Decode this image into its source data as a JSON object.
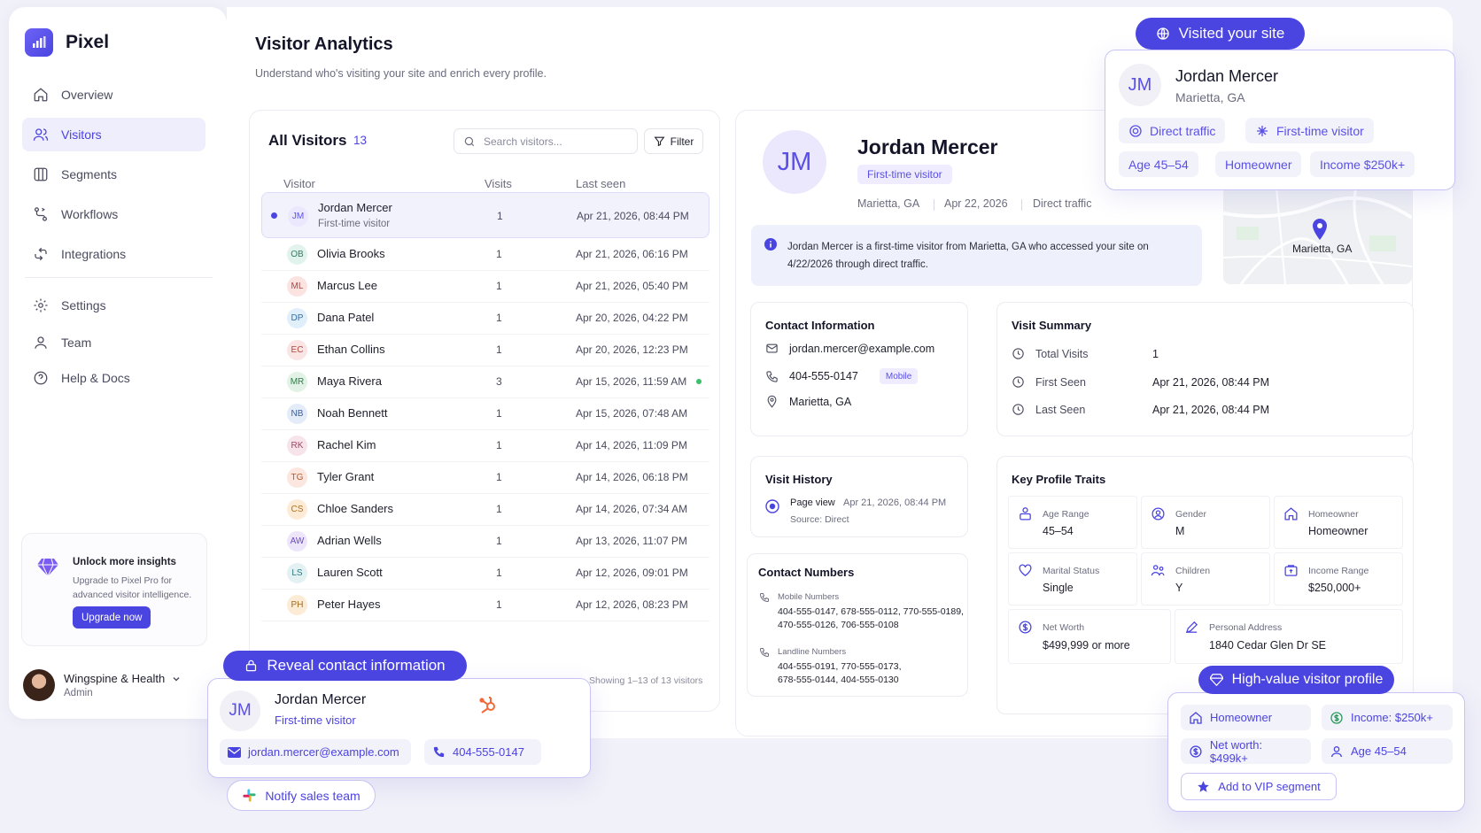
{
  "brand": {
    "name": "Pixel"
  },
  "nav": {
    "items": [
      {
        "label": "Overview",
        "icon": "home-icon"
      },
      {
        "label": "Visitors",
        "icon": "users-icon"
      },
      {
        "label": "Segments",
        "icon": "segments-icon"
      },
      {
        "label": "Workflows",
        "icon": "workflow-icon"
      },
      {
        "label": "Integrations",
        "icon": "integrations-icon"
      },
      {
        "label": "Settings",
        "icon": "gear-icon"
      },
      {
        "label": "Team",
        "icon": "team-icon"
      },
      {
        "label": "Help & Docs",
        "icon": "help-icon"
      }
    ]
  },
  "upsell": {
    "title": "Unlock more insights",
    "desc": "Upgrade to Pixel Pro for advanced visitor intelligence.",
    "button": "Upgrade now"
  },
  "account": {
    "name": "Wingspine & Health",
    "role": "Admin"
  },
  "page": {
    "title": "Visitor Analytics",
    "subtitle": "Understand who's visiting your site and enrich every profile."
  },
  "list": {
    "title": "All Visitors",
    "count": "13",
    "search_placeholder": "Search visitors...",
    "filter": "Filter",
    "col_visitor": "Visitor",
    "col_visits": "Visits",
    "col_last_seen": "Last seen",
    "rows": [
      {
        "initials": "JM",
        "name": "Jordan Mercer",
        "sub": "First-time visitor",
        "visits": "1",
        "last_seen": "Apr 21, 2026, 08:44 PM",
        "bg": "#ebe8fd",
        "fg": "#5a50e6"
      },
      {
        "initials": "OB",
        "name": "Olivia Brooks",
        "visits": "1",
        "last_seen": "Apr 21, 2026, 06:16 PM",
        "bg": "#e2f3ee",
        "fg": "#2f7d62"
      },
      {
        "initials": "ML",
        "name": "Marcus Lee",
        "visits": "1",
        "last_seen": "Apr 21, 2026, 05:40 PM",
        "bg": "#fbe3e1",
        "fg": "#b0473d"
      },
      {
        "initials": "DP",
        "name": "Dana Patel",
        "visits": "1",
        "last_seen": "Apr 20, 2026, 04:22 PM",
        "bg": "#e1effb",
        "fg": "#2f6ea8"
      },
      {
        "initials": "EC",
        "name": "Ethan Collins",
        "visits": "1",
        "last_seen": "Apr 20, 2026, 12:23 PM",
        "bg": "#fbe4e4",
        "fg": "#b0473d"
      },
      {
        "initials": "MR",
        "name": "Maya Rivera",
        "visits": "3",
        "last_seen": "Apr 15, 2026, 11:59 AM",
        "bg": "#e2f2e6",
        "fg": "#2f7d4a"
      },
      {
        "initials": "NB",
        "name": "Noah Bennett",
        "visits": "1",
        "last_seen": "Apr 15, 2026, 07:48 AM",
        "bg": "#e3ecf8",
        "fg": "#3b5f9a"
      },
      {
        "initials": "RK",
        "name": "Rachel Kim",
        "visits": "1",
        "last_seen": "Apr 14, 2026, 11:09 PM",
        "bg": "#f6e4ea",
        "fg": "#a04566"
      },
      {
        "initials": "TG",
        "name": "Tyler Grant",
        "visits": "1",
        "last_seen": "Apr 14, 2026, 06:18 PM",
        "bg": "#fbe7df",
        "fg": "#b45a33"
      },
      {
        "initials": "CS",
        "name": "Chloe Sanders",
        "visits": "1",
        "last_seen": "Apr 14, 2026, 07:34 AM",
        "bg": "#fdebd6",
        "fg": "#b0701f"
      },
      {
        "initials": "AW",
        "name": "Adrian Wells",
        "visits": "1",
        "last_seen": "Apr 13, 2026, 11:07 PM",
        "bg": "#ede6fb",
        "fg": "#6c48c4"
      },
      {
        "initials": "LS",
        "name": "Lauren Scott",
        "visits": "1",
        "last_seen": "Apr 12, 2026, 09:01 PM",
        "bg": "#e3f1f2",
        "fg": "#2f7b80"
      },
      {
        "initials": "PH",
        "name": "Peter Hayes",
        "visits": "1",
        "last_seen": "Apr 12, 2026, 08:23 PM",
        "bg": "#fcecd6",
        "fg": "#a5691c"
      }
    ],
    "footer": "Showing 1–13 of 13 visitors"
  },
  "detail": {
    "initials": "JM",
    "name": "Jordan Mercer",
    "badge": "First-time visitor",
    "location": "Marietta, GA",
    "date": "Apr 22, 2026",
    "source": "Direct traffic",
    "info": "Jordan Mercer is a first-time visitor from Marietta, GA who accessed your site on 4/22/2026 through direct traffic.",
    "map_label": "Marietta, GA",
    "contact": {
      "title": "Contact Information",
      "email": "jordan.mercer@example.com",
      "phone": "404-555-0147",
      "phone_tag": "Mobile",
      "location": "Marietta, GA"
    },
    "summary": {
      "title": "Visit Summary",
      "total_label": "Total Visits",
      "total": "1",
      "first_label": "First Seen",
      "first": "Apr 21, 2026, 08:44 PM",
      "last_label": "Last Seen",
      "last": "Apr 21, 2026, 08:44 PM"
    },
    "history": {
      "title": "Visit History",
      "event": "Page view",
      "time": "Apr 21, 2026, 08:44 PM",
      "source": "Source: Direct"
    },
    "numbers": {
      "title": "Contact Numbers",
      "mobile_label": "Mobile Numbers",
      "mobile_1": "404-555-0147, 678-555-0112, 770-555-0189,",
      "mobile_2": "470-555-0126, 706-555-0108",
      "landline_label": "Landline Numbers",
      "landline_1": "404-555-0191, 770-555-0173,",
      "landline_2": "678-555-0144, 404-555-0130"
    },
    "traits": {
      "title": "Key Profile Traits",
      "age_label": "Age Range",
      "age": "45–54",
      "gender_label": "Gender",
      "gender": "M",
      "home_label": "Homeowner",
      "home": "Homeowner",
      "marital_label": "Marital Status",
      "marital": "Single",
      "children_label": "Children",
      "children": "Y",
      "income_label": "Income Range",
      "income": "$250,000+",
      "networth_label": "Net Worth",
      "networth": "$499,999 or more",
      "address_label": "Personal Address",
      "address": "1840 Cedar Glen Dr SE"
    }
  },
  "overlay_visited": {
    "pill": "Visited your site",
    "initials": "JM",
    "name": "Jordan Mercer",
    "location": "Marietta, GA",
    "chips": [
      "Direct traffic",
      "First-time visitor",
      "Age 45–54",
      "Homeowner",
      "Income $250k+"
    ]
  },
  "overlay_reveal": {
    "pill": "Reveal contact information",
    "initials": "JM",
    "name": "Jordan Mercer",
    "sub": "First-time visitor",
    "email": "jordan.mercer@example.com",
    "phone": "404-555-0147",
    "notify": "Notify sales team"
  },
  "overlay_vip": {
    "pill": "High-value visitor profile",
    "chips": [
      "Homeowner",
      "Income: $250k+",
      "Net worth: $499k+",
      "Age 45–54"
    ],
    "button": "Add to VIP segment"
  },
  "colors": {
    "accent": "#4a44e0",
    "accent_soft": "#eeecfe",
    "online": "#3bbf6a"
  }
}
